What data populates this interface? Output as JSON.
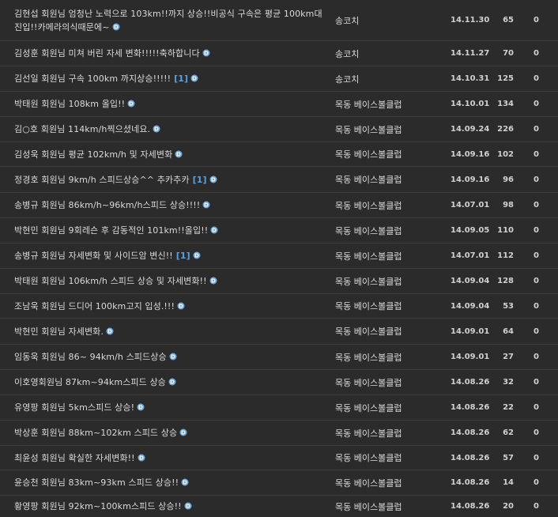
{
  "board": {
    "rows": [
      {
        "title": "김현섭 회원님 엄청난 노력으로 103km!!까지 상승!!비공식 구속은 평균 100km대진입!!카메라의식때문에~",
        "comment": "",
        "author": "송코치",
        "date": "14.11.30",
        "views": "65",
        "likes": "0"
      },
      {
        "title": "김성훈 회원님 미쳐 버린 자세 변화!!!!!축하합니다",
        "comment": "",
        "author": "송코치",
        "date": "14.11.27",
        "views": "70",
        "likes": "0"
      },
      {
        "title": "김선일 회원님 구속 100km 까지상승!!!!!",
        "comment": "[1]",
        "author": "송코치",
        "date": "14.10.31",
        "views": "125",
        "likes": "0"
      },
      {
        "title": "박태원 회원님 108km 올입!!",
        "comment": "",
        "author": "목동 베이스볼클럽",
        "date": "14.10.01",
        "views": "134",
        "likes": "0"
      },
      {
        "title": "김○호 회원님 114km/h찍으셨네요.",
        "comment": "",
        "author": "목동 베이스볼클럽",
        "date": "14.09.24",
        "views": "226",
        "likes": "0"
      },
      {
        "title": "김성욱 회원님 평균 102km/h 및 자세변화",
        "comment": "",
        "author": "목동 베이스볼클럽",
        "date": "14.09.16",
        "views": "102",
        "likes": "0"
      },
      {
        "title": "정경호 회원님 9km/h 스피드상승^^ 추카추카",
        "comment": "[1]",
        "author": "목동 베이스볼클럽",
        "date": "14.09.16",
        "views": "96",
        "likes": "0"
      },
      {
        "title": "송병규 회원님 86km/h~96km/h스피드 상승!!!!",
        "comment": "",
        "author": "목동 베이스볼클럽",
        "date": "14.07.01",
        "views": "98",
        "likes": "0"
      },
      {
        "title": "박현민 회원님 9회레슨 후 감동적인 101km!!올입!!",
        "comment": "",
        "author": "목동 베이스볼클럽",
        "date": "14.09.05",
        "views": "110",
        "likes": "0"
      },
      {
        "title": "송병규 회원님 자세변화 및 사이드암 변신!!",
        "comment": "[1]",
        "author": "목동 베이스볼클럽",
        "date": "14.07.01",
        "views": "112",
        "likes": "0"
      },
      {
        "title": "박태원 회원님 106km/h 스피드 상승 및 자세변화!!",
        "comment": "",
        "author": "목동 베이스볼클럽",
        "date": "14.09.04",
        "views": "128",
        "likes": "0"
      },
      {
        "title": "조남욱 회원님 드디어 100km고지 입성.!!!",
        "comment": "",
        "author": "목동 베이스볼클럽",
        "date": "14.09.04",
        "views": "53",
        "likes": "0"
      },
      {
        "title": "박현민 회원님 자세변화.",
        "comment": "",
        "author": "목동 베이스볼클럽",
        "date": "14.09.01",
        "views": "64",
        "likes": "0"
      },
      {
        "title": "임동욱 회원님 86~ 94km/h 스피드상승",
        "comment": "",
        "author": "목동 베이스볼클럽",
        "date": "14.09.01",
        "views": "27",
        "likes": "0"
      },
      {
        "title": "이호영회원님 87km~94km스피드 상승",
        "comment": "",
        "author": "목동 베이스볼클럽",
        "date": "14.08.26",
        "views": "32",
        "likes": "0"
      },
      {
        "title": "유영팡 회원님 5km스피드 상승!",
        "comment": "",
        "author": "목동 베이스볼클럽",
        "date": "14.08.26",
        "views": "22",
        "likes": "0"
      },
      {
        "title": "박상훈 회원님 88km~102km 스피드 상승",
        "comment": "",
        "author": "목동 베이스볼클럽",
        "date": "14.08.26",
        "views": "62",
        "likes": "0"
      },
      {
        "title": "최윤성 회원님 확실한 자세변화!!",
        "comment": "",
        "author": "목동 베이스볼클럽",
        "date": "14.08.26",
        "views": "57",
        "likes": "0"
      },
      {
        "title": "윤승천 회원님 83km~93km 스피드 상승!!",
        "comment": "",
        "author": "목동 베이스볼클럽",
        "date": "14.08.26",
        "views": "14",
        "likes": "0"
      },
      {
        "title": "황영팡 회원님 92km~100km스피드 상승!!",
        "comment": "",
        "author": "목동 베이스볼클럽",
        "date": "14.08.26",
        "views": "20",
        "likes": "0"
      }
    ]
  },
  "colors": {
    "background": "#2b2b2b",
    "text": "#dadada",
    "comment": "#4fa3e6",
    "new_badge": "#6fa8dc",
    "divider": "#3d3d3d"
  },
  "icons": {
    "new_badge": "new-post-d-icon"
  }
}
